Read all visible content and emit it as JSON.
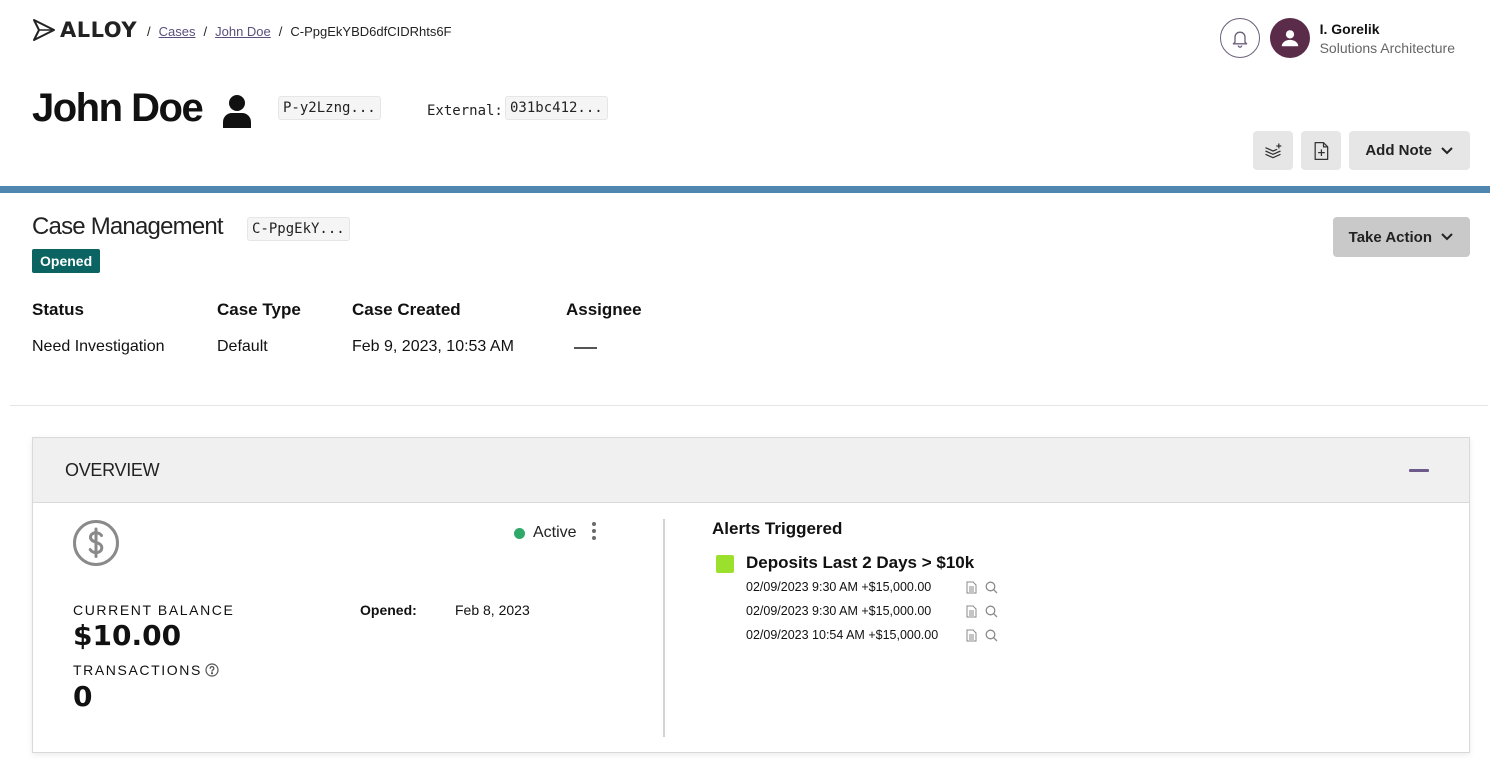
{
  "header": {
    "logo_text": "ALLOY",
    "breadcrumb": {
      "cases": "Cases",
      "person": "John Doe",
      "current": "C-PpgEkYBD6dfCIDRhts6F"
    },
    "user": {
      "name": "I. Gorelik",
      "role": "Solutions Architecture"
    }
  },
  "entity": {
    "name": "John Doe",
    "id_chip": "P-y2Lzng...",
    "external_label": "External:",
    "external_chip": "031bc412..."
  },
  "toolbar": {
    "add_note_label": "Add Note"
  },
  "case": {
    "title": "Case Management",
    "id_chip": "C-PpgEkY...",
    "badge": "Opened",
    "take_action_label": "Take Action",
    "fields": {
      "status_label": "Status",
      "status_value": "Need Investigation",
      "type_label": "Case Type",
      "type_value": "Default",
      "created_label": "Case Created",
      "created_value": "Feb 9, 2023, 10:53 AM",
      "assignee_label": "Assignee"
    }
  },
  "overview": {
    "title": "OVERVIEW",
    "account": {
      "status": "Active",
      "balance_label": "CURRENT BALANCE",
      "balance_value": "$10.00",
      "transactions_label": "TRANSACTIONS",
      "transactions_value": "0",
      "opened_label": "Opened:",
      "opened_value": "Feb 8, 2023"
    },
    "alerts": {
      "title": "Alerts Triggered",
      "rule_name": "Deposits Last 2 Days > $10k",
      "rows": [
        "02/09/2023 9:30 AM +$15,000.00",
        "02/09/2023 9:30 AM +$15,000.00",
        "02/09/2023 10:54 AM +$15,000.00"
      ]
    }
  },
  "colors": {
    "accent_bar": "#4f86b0",
    "badge_green": "#0b6461",
    "active_dot": "#2ea96a",
    "alert_square": "#9be02c",
    "avatar_bg": "#5b2b4a"
  }
}
